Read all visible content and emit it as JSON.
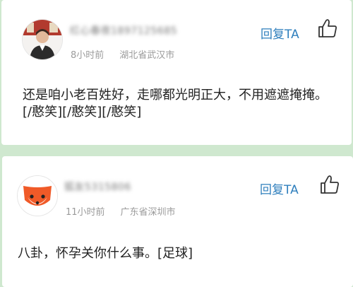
{
  "comments": [
    {
      "username": "红心春夜1897125685",
      "time": "8小时前",
      "location": "湖北省武汉市",
      "reply_label": "回复TA",
      "content": "还是咱小老百姓好，走哪都光明正大，不用遮遮掩掩。[/憨笑][/憨笑][/憨笑]",
      "avatar": "person-photo-avatar"
    },
    {
      "username": "狐友5315806",
      "time": "11小时前",
      "location": "广东省深圳市",
      "reply_label": "回复TA",
      "content": "八卦，怀孕关你什么事。[足球]",
      "avatar": "fox-avatar"
    }
  ],
  "icons": {
    "like": "thumbs-up-icon"
  },
  "colors": {
    "accent": "#2f7fbd",
    "background": "#cfe8cf",
    "meta": "#9b9b9b"
  }
}
